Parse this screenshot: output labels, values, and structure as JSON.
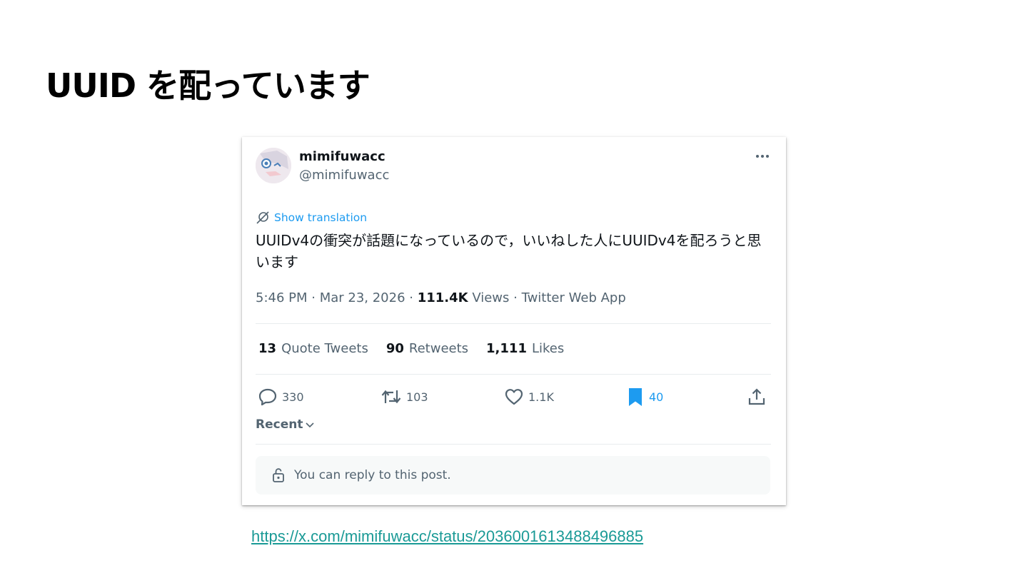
{
  "slide": {
    "title": "UUID を配っています",
    "link": "https://x.com/mimifuwacc/status/2036001613488496885"
  },
  "tweet": {
    "name": "mimifuwacc",
    "handle": "@mimifuwacc",
    "translate_label": "Show translation",
    "text": "UUIDv4の衝突が話題になっているので，いいねした人にUUIDv4を配ろうと思います",
    "time": "5:46 PM · Mar 23, 2026 · ",
    "views_count": "111.4K",
    "views_suffix": " Views · Twitter Web App",
    "stats": {
      "quotes_count": "13",
      "quotes_label": "Quote Tweets",
      "retweets_count": "90",
      "retweets_label": "Retweets",
      "likes_count": "1,111",
      "likes_label": "Likes"
    },
    "actions": {
      "replies": "330",
      "retweets": "103",
      "likes": "1.1K",
      "bookmarks": "40"
    },
    "recent_label": "Recent",
    "reply_notice": "You can reply to this post.",
    "colors": {
      "accent": "#1d9bf0",
      "muted": "#536471",
      "text": "#0f1419",
      "link": "#1a9a96"
    },
    "icons": [
      "more-icon",
      "translate-icon",
      "reply-icon",
      "retweet-icon",
      "like-icon",
      "bookmark-icon",
      "share-icon",
      "chevron-down-icon",
      "lock-icon"
    ]
  }
}
